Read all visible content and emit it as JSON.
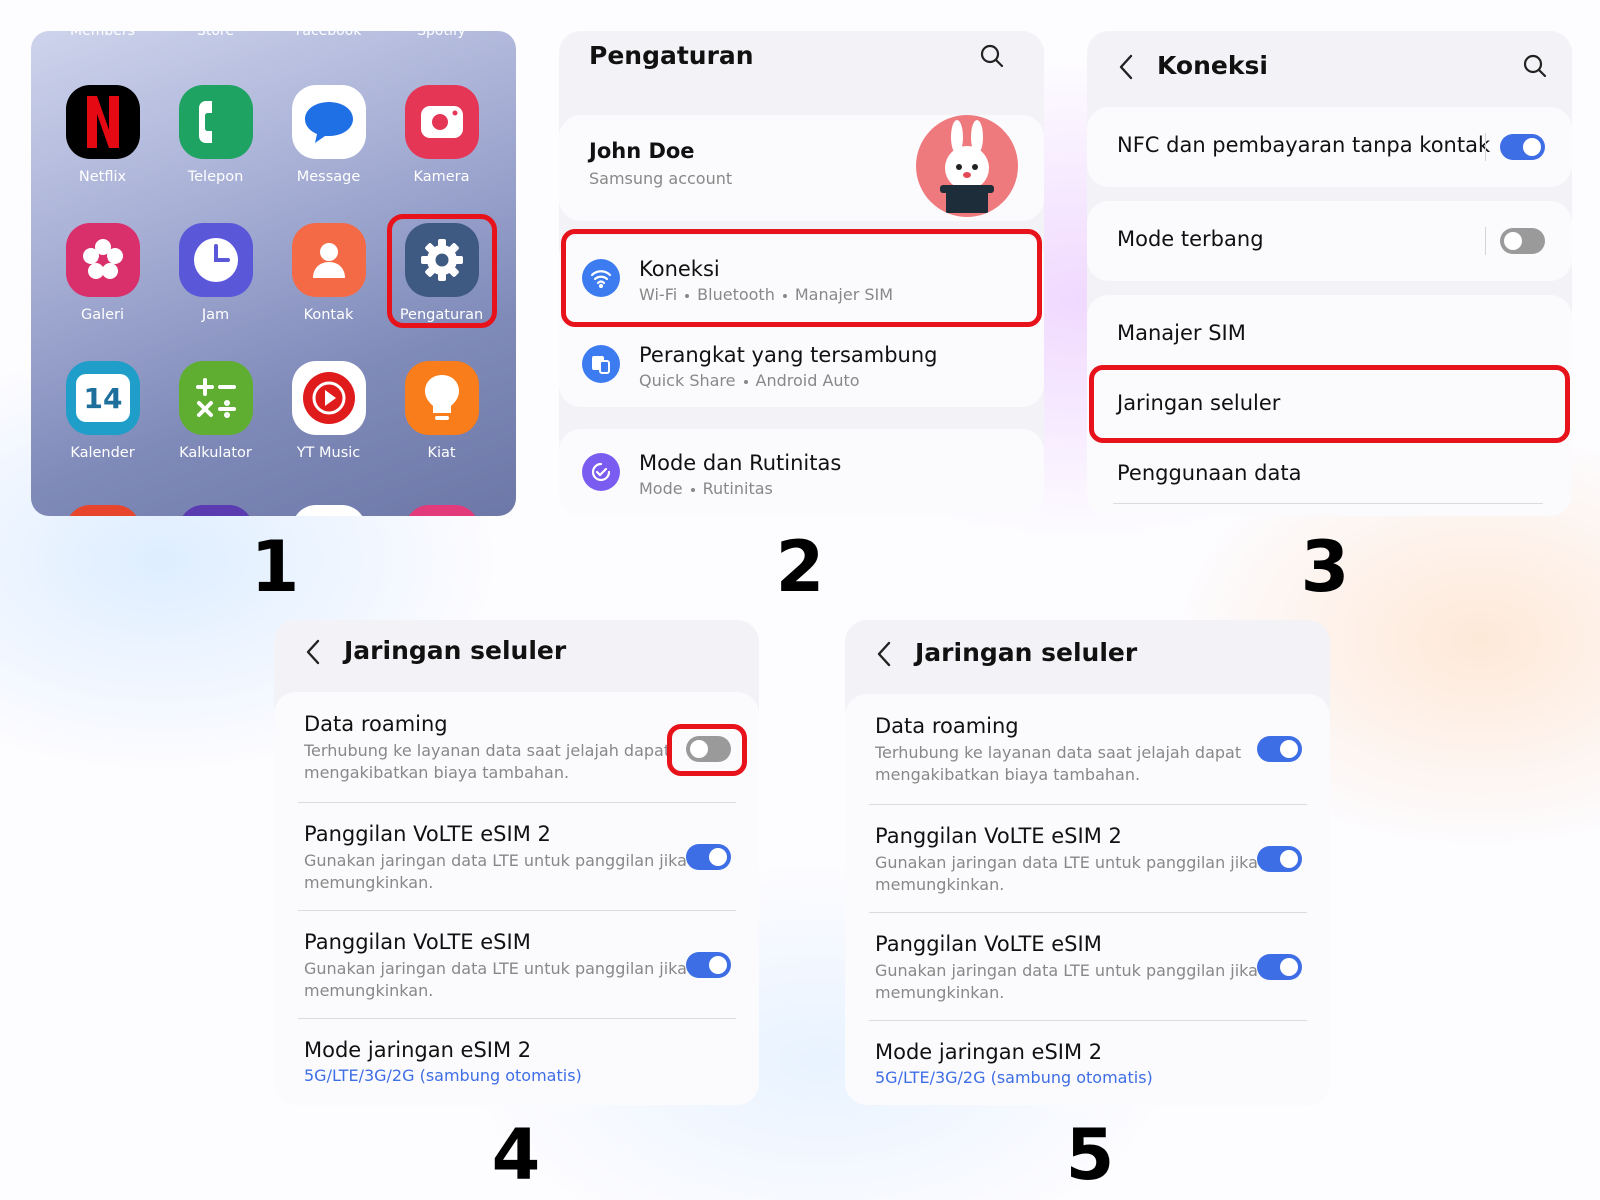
{
  "steps": [
    "1",
    "2",
    "3",
    "4",
    "5"
  ],
  "home": {
    "top_labels": [
      "Members",
      "Store",
      "Facebook",
      "Spotify"
    ],
    "apps": [
      {
        "label": "Netflix",
        "icon": "netflix-icon",
        "color": "#000000"
      },
      {
        "label": "Telepon",
        "icon": "phone-icon",
        "color": "#1ea362"
      },
      {
        "label": "Message",
        "icon": "message-icon",
        "color": "#ffffff"
      },
      {
        "label": "Kamera",
        "icon": "camera-icon",
        "color": "#e53656"
      },
      {
        "label": "Galeri",
        "icon": "gallery-icon",
        "color": "#d92f6b"
      },
      {
        "label": "Jam",
        "icon": "clock-icon",
        "color": "#5a57d9"
      },
      {
        "label": "Kontak",
        "icon": "contacts-icon",
        "color": "#f46a46"
      },
      {
        "label": "Pengaturan",
        "icon": "gear-icon",
        "color": "#3f5a82"
      },
      {
        "label": "Kalender",
        "icon": "calendar-icon",
        "color": "#1e9ec9",
        "day": "14"
      },
      {
        "label": "Kalkulator",
        "icon": "calculator-icon",
        "color": "#5fae32"
      },
      {
        "label": "YT Music",
        "icon": "yt-music-icon",
        "color": "#ffffff"
      },
      {
        "label": "Kiat",
        "icon": "tips-icon",
        "color": "#f97d1a"
      }
    ]
  },
  "settings": {
    "title": "Pengaturan",
    "account": {
      "name": "John Doe",
      "sub": "Samsung account"
    },
    "items": [
      {
        "title": "Koneksi",
        "subs": [
          "Wi-Fi",
          "Bluetooth",
          "Manajer SIM"
        ],
        "icon": "wifi-icon",
        "color": "#3d7bf0"
      },
      {
        "title": "Perangkat yang tersambung",
        "subs": [
          "Quick Share",
          "Android Auto"
        ],
        "icon": "devices-icon",
        "color": "#3d7bf0"
      },
      {
        "title": "Mode dan Rutinitas",
        "subs": [
          "Mode",
          "Rutinitas"
        ],
        "icon": "routines-icon",
        "color": "#7a5cf0"
      }
    ]
  },
  "koneksi": {
    "title": "Koneksi",
    "items": [
      {
        "title": "NFC dan pembayaran tanpa kontak",
        "toggle": true
      },
      {
        "title": "Mode terbang",
        "toggle": false
      },
      {
        "title": "Manajer SIM"
      },
      {
        "title": "Jaringan seluler"
      },
      {
        "title": "Penggunaan data"
      }
    ]
  },
  "jaringan_before": {
    "title": "Jaringan seluler",
    "items": [
      {
        "title": "Data roaming",
        "desc1": "Terhubung ke layanan data saat jelajah dapat",
        "desc2": "mengakibatkan biaya tambahan.",
        "toggle": false
      },
      {
        "title": "Panggilan VoLTE eSIM 2",
        "desc1": "Gunakan jaringan data LTE untuk panggilan jika",
        "desc2": "memungkinkan.",
        "toggle": true
      },
      {
        "title": "Panggilan VoLTE eSIM",
        "desc1": "Gunakan jaringan data LTE untuk panggilan jika",
        "desc2": "memungkinkan.",
        "toggle": true
      },
      {
        "title": "Mode jaringan eSIM 2",
        "value": "5G/LTE/3G/2G (sambung otomatis)"
      }
    ]
  },
  "jaringan_after": {
    "title": "Jaringan seluler",
    "items": [
      {
        "title": "Data roaming",
        "desc1": "Terhubung ke layanan data saat jelajah dapat",
        "desc2": "mengakibatkan biaya tambahan.",
        "toggle": true
      },
      {
        "title": "Panggilan VoLTE eSIM 2",
        "desc1": "Gunakan jaringan data LTE untuk panggilan jika",
        "desc2": "memungkinkan.",
        "toggle": true
      },
      {
        "title": "Panggilan VoLTE eSIM",
        "desc1": "Gunakan jaringan data LTE untuk panggilan jika",
        "desc2": "memungkinkan.",
        "toggle": true
      },
      {
        "title": "Mode jaringan eSIM 2",
        "value": "5G/LTE/3G/2G (sambung otomatis)"
      }
    ]
  },
  "colors": {
    "highlight": "#e8121b",
    "accent": "#3e6ee6"
  }
}
